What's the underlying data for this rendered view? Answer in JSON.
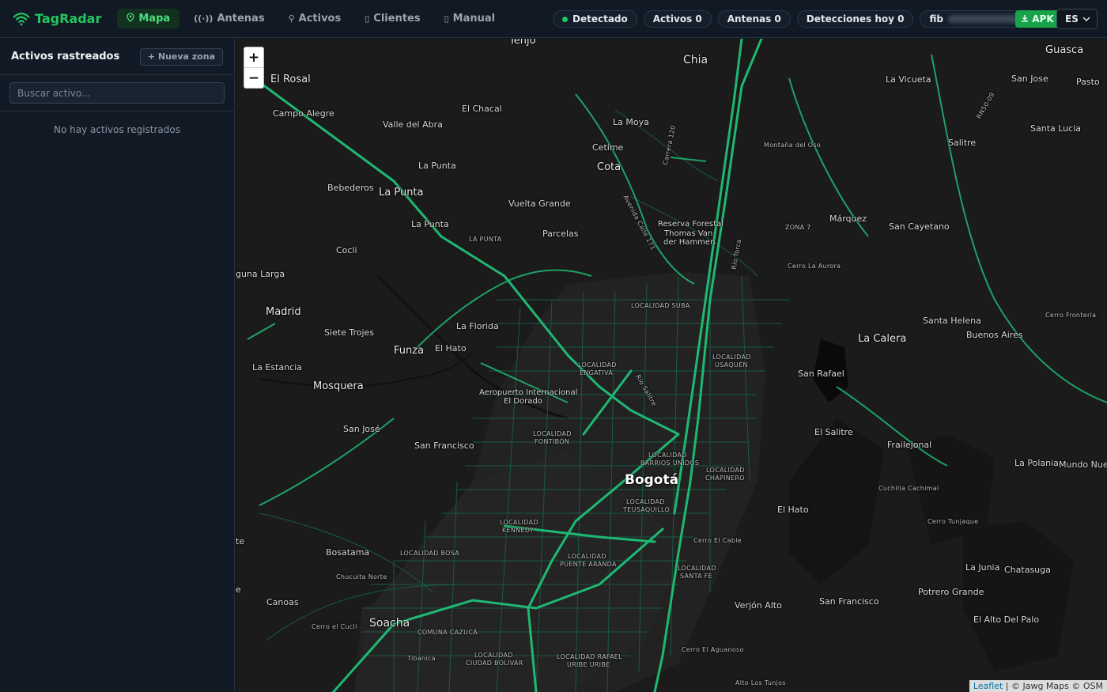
{
  "app": {
    "name": "TagRadar"
  },
  "nav": [
    {
      "label": "Mapa",
      "icon": "pin-icon",
      "active": true
    },
    {
      "label": "Antenas",
      "icon": "antenna-icon",
      "active": false
    },
    {
      "label": "Activos",
      "icon": "tag-icon",
      "active": false
    },
    {
      "label": "Clientes",
      "icon": "clients-icon",
      "active": false
    },
    {
      "label": "Manual",
      "icon": "book-icon",
      "active": false
    }
  ],
  "status": {
    "detected": "Detectado",
    "activos": "Activos 0",
    "antenas": "Antenas 0",
    "detecciones": "Detecciones hoy 0",
    "user_prefix": "fib"
  },
  "apk_label": "APK",
  "language": "ES",
  "sidebar": {
    "title": "Activos rastreados",
    "new_zone_label": "+ Nueva zona",
    "search_placeholder": "Buscar activo...",
    "empty_text": "No hay activos registrados"
  },
  "map": {
    "zoom_in": "+",
    "zoom_out": "−",
    "attribution_link": "Leaflet",
    "attribution_text": " | © Jawg Maps © OSM",
    "places": {
      "tenjo": "Tenjo",
      "chia": "Chia",
      "guasca": "Guasca",
      "el_rosal": "El Rosal",
      "la_vicueta": "La Vicueta",
      "san_jose_n": "San Jose",
      "pasto": "Pasto",
      "rn5009": "RN50-09",
      "el_chacal": "El Chacal",
      "campo_alegre": "Campo Alegre",
      "valle_abra": "Valle del Abra",
      "la_moya": "La Moya",
      "carrera_120": "Carrera 120",
      "santa_lucia": "Santa Lucia",
      "cetime": "Cetime",
      "montana_oso": "Montaña del Oso",
      "salitre_n": "Salitre",
      "la_punta_1": "La Punta",
      "cota": "Cota",
      "bebederos": "Bebederos",
      "la_punta_2": "La Punta",
      "vuelta_grande": "Vuelta Grande",
      "av_calle_171": "Avenida Calle 171",
      "reserva": "Reserva Forestal",
      "reserva2": "Thomas Van",
      "reserva3": "der Hammen",
      "marquez": "Márquez",
      "zona7": "ZONA 7",
      "san_cayetano": "San Cayetano",
      "la_punta_3": "La Punta",
      "la_punta_caps": "LA PUNTA",
      "parcelas": "Parcelas",
      "rio_torca": "Río Torca",
      "cocli": "Cocli",
      "cerro_aurora": "Cerro La Aurora",
      "laguna_larga": "guna Larga",
      "loc_suba": "LOCALIDAD SUBA",
      "madrid": "Madrid",
      "santa_helena": "Santa Helena",
      "cerro_frontera": "Cerro Frontería",
      "siete_trojes": "Siete Trojes",
      "la_florida": "La Florida",
      "la_calera": "La Calera",
      "buenos_aires": "Buenos Aires",
      "funza": "Funza",
      "el_hato_w": "El Hato",
      "loc_usaquen": "LOCALIDAD",
      "loc_usaquen2": "USAQUÉN",
      "loc_engativa": "LOCALIDAD",
      "loc_engativa2": "ENGATIVÁ",
      "la_estancia": "La Estancia",
      "san_rafael": "San Rafael",
      "rio_salitre": "Río Salitre",
      "mosquera": "Mosquera",
      "aeropuerto": "Aeropuerto Internacional",
      "aeropuerto2": "El Dorado",
      "el_salitre": "El Salitre",
      "san_jose_w": "San José",
      "loc_fontibon": "LOCALIDAD",
      "loc_fontibon2": "FONTIBÓN",
      "frailejonal": "Frailejonal",
      "san_francisco_w": "San Francisco",
      "loc_barrios": "LOCALIDAD",
      "loc_barrios2": "BARRIOS UNIDOS",
      "la_polania": "La Polania",
      "mundo_nuevo": "Mundo Nuevo",
      "loc_chapinero": "LOCALIDAD",
      "loc_chapinero2": "CHAPINERO",
      "bogota": "Bogotá",
      "cuchilla": "Cuchilla Cachimal",
      "loc_teusaquillo": "LOCALIDAD",
      "loc_teusaquillo2": "TEUSAQUILLO",
      "el_hato_e": "El Hato",
      "loc_kennedy": "LOCALIDAD",
      "loc_kennedy2": "KENNEDY",
      "cerro_tunjaque": "Cerro Tunjaque",
      "te": "te",
      "cerro_cable": "Cerro El Cable",
      "bosatama": "Bosatama",
      "loc_bosa": "LOCALIDAD BOSA",
      "loc_puente": "LOCALIDAD",
      "loc_puente2": "PUENTE ARANDA",
      "la_junia": "La Junia",
      "chatasuga": "Chatasuga",
      "chucuita": "Chucuita Norte",
      "loc_santafe": "LOCALIDAD",
      "loc_santafe2": "SANTA FE",
      "e": "e",
      "potrero_grande": "Potrero Grande",
      "canoas": "Canoas",
      "verjon": "Verjón Alto",
      "san_francisco_e": "San Francisco",
      "el_alto_palo": "El Alto Del Palo",
      "cerro_cucli": "Cerro el Cucli",
      "soacha": "Soacha",
      "comuna": "COMUNA CAZUCÁ",
      "tibanica": "Tibanica",
      "loc_ciudad_bolivar": "LOCALIDAD",
      "loc_ciudad_bolivar2": "CIUDAD BOLÍVAR",
      "loc_rafael": "LOCALIDAD RAFAEL",
      "loc_rafael2": "URIBE URIBE",
      "cerro_aguanoso": "Cerro El Aguanoso",
      "alto_tunjos": "Alto Los Tunjos"
    }
  },
  "colors": {
    "accent": "#22c55e",
    "road": "#1fb873",
    "map_bg": "#1b1b1b"
  }
}
